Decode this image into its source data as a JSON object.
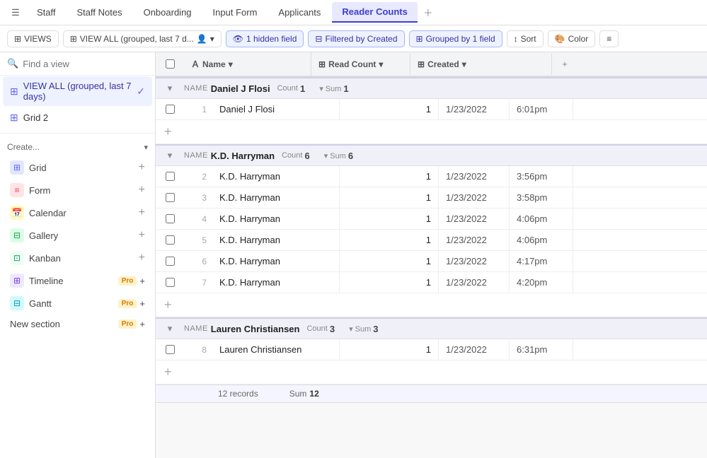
{
  "tabs": [
    {
      "id": "staff",
      "label": "Staff",
      "active": false
    },
    {
      "id": "staff-notes",
      "label": "Staff Notes",
      "active": false
    },
    {
      "id": "onboarding",
      "label": "Onboarding",
      "active": false
    },
    {
      "id": "input-form",
      "label": "Input Form",
      "active": false
    },
    {
      "id": "applicants",
      "label": "Applicants",
      "active": false
    },
    {
      "id": "reader-counts",
      "label": "Reader Counts",
      "active": true
    }
  ],
  "toolbar": {
    "views_label": "VIEWS",
    "view_all_label": "VIEW ALL (grouped, last 7 d...",
    "hidden_field_label": "1 hidden field",
    "filter_label": "Filtered by Created",
    "group_label": "Grouped by 1 field",
    "sort_label": "Sort",
    "color_label": "Color"
  },
  "sidebar": {
    "search_placeholder": "Find a view",
    "views": [
      {
        "id": "view-all",
        "label": "VIEW ALL (grouped, last 7 days)",
        "active": true
      },
      {
        "id": "grid-2",
        "label": "Grid 2",
        "active": false
      }
    ],
    "create_label": "Create...",
    "create_items": [
      {
        "id": "grid",
        "label": "Grid",
        "icon": "⊞",
        "pro": false
      },
      {
        "id": "form",
        "label": "Form",
        "icon": "≡",
        "pro": false
      },
      {
        "id": "calendar",
        "label": "Calendar",
        "icon": "📅",
        "pro": false
      },
      {
        "id": "gallery",
        "label": "Gallery",
        "icon": "⊟",
        "pro": false
      },
      {
        "id": "kanban",
        "label": "Kanban",
        "icon": "⊡",
        "pro": false
      },
      {
        "id": "timeline",
        "label": "Timeline",
        "icon": "⊞",
        "pro": true
      },
      {
        "id": "gantt",
        "label": "Gantt",
        "icon": "⊟",
        "pro": true
      }
    ],
    "new_section_label": "New section",
    "new_section_pro": true
  },
  "table": {
    "col_name": "Name",
    "col_readcount": "Read Count",
    "col_created": "Created",
    "groups": [
      {
        "name": "Daniel J Flosi",
        "count": 1,
        "sum": 1,
        "rows": [
          {
            "num": 1,
            "name": "Daniel J Flosi",
            "read_count": 1,
            "date": "1/23/2022",
            "time": "6:01pm"
          }
        ]
      },
      {
        "name": "K.D. Harryman",
        "count": 6,
        "sum": 6,
        "rows": [
          {
            "num": 2,
            "name": "K.D. Harryman",
            "read_count": 1,
            "date": "1/23/2022",
            "time": "3:56pm"
          },
          {
            "num": 3,
            "name": "K.D. Harryman",
            "read_count": 1,
            "date": "1/23/2022",
            "time": "3:58pm"
          },
          {
            "num": 4,
            "name": "K.D. Harryman",
            "read_count": 1,
            "date": "1/23/2022",
            "time": "4:06pm"
          },
          {
            "num": 5,
            "name": "K.D. Harryman",
            "read_count": 1,
            "date": "1/23/2022",
            "time": "4:06pm"
          },
          {
            "num": 6,
            "name": "K.D. Harryman",
            "read_count": 1,
            "date": "1/23/2022",
            "time": "4:17pm"
          },
          {
            "num": 7,
            "name": "K.D. Harryman",
            "read_count": 1,
            "date": "1/23/2022",
            "time": "4:20pm"
          }
        ]
      },
      {
        "name": "Lauren Christiansen",
        "count": 3,
        "sum": 3,
        "rows": [
          {
            "num": 8,
            "name": "Lauren Christiansen",
            "read_count": 1,
            "date": "1/23/2022",
            "time": "6:31pm"
          }
        ]
      }
    ],
    "footer_records": "12 records",
    "footer_sum_label": "Sum",
    "footer_sum_value": "12"
  }
}
